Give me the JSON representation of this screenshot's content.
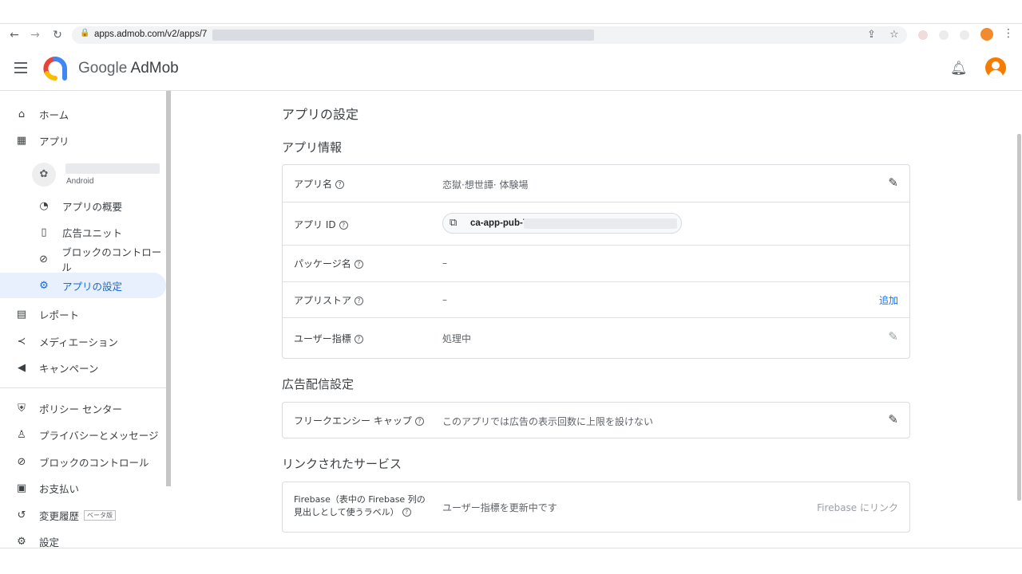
{
  "browser": {
    "url": "apps.admob.com/v2/apps/7",
    "back_icon": "arrow-left-icon",
    "forward_icon": "arrow-right-icon",
    "reload_icon": "reload-icon"
  },
  "header": {
    "brand_google": "Google",
    "brand_product": "AdMob"
  },
  "sidebar": {
    "items": [
      {
        "label": "ホーム",
        "icon": "home-icon"
      },
      {
        "label": "アプリ",
        "icon": "apps-grid-icon"
      },
      {
        "label": "アプリの概要",
        "icon": "gauge-icon"
      },
      {
        "label": "広告ユニット",
        "icon": "ad-unit-icon"
      },
      {
        "label": "ブロックのコントロール",
        "icon": "block-icon"
      },
      {
        "label": "アプリの設定",
        "icon": "settings-box-icon"
      },
      {
        "label": "レポート",
        "icon": "report-icon"
      },
      {
        "label": "メディエーション",
        "icon": "mediation-icon"
      },
      {
        "label": "キャンペーン",
        "icon": "campaign-icon"
      },
      {
        "label": "ポリシー センター",
        "icon": "shield-icon"
      },
      {
        "label": "プライバシーとメッセージ",
        "icon": "privacy-icon"
      },
      {
        "label": "ブロックのコントロール",
        "icon": "block-icon"
      },
      {
        "label": "お支払い",
        "icon": "payments-icon"
      },
      {
        "label": "変更履歴",
        "icon": "history-icon",
        "badge": "ベータ版"
      },
      {
        "label": "設定",
        "icon": "gear-icon"
      }
    ],
    "app_platform": "Android"
  },
  "main": {
    "page_title": "アプリの設定",
    "app_info": {
      "title": "アプリ情報",
      "rows": [
        {
          "label": "アプリ名",
          "value": "恋獄·想世譚· 体験場"
        },
        {
          "label": "アプリ ID",
          "value": "ca-app-pub-7"
        },
        {
          "label": "パッケージ名",
          "value": "–"
        },
        {
          "label": "アプリストア",
          "value": "–",
          "action": "追加"
        },
        {
          "label": "ユーザー指標",
          "value": "処理中"
        }
      ]
    },
    "ad_delivery": {
      "title": "広告配信設定",
      "rows": [
        {
          "label": "フリークエンシー キャップ",
          "value": "このアプリでは広告の表示回数に上限を設けない"
        }
      ]
    },
    "linked_services": {
      "title": "リンクされたサービス",
      "rows": [
        {
          "label_line1": "Firebase（表中の Firebase 列の",
          "label_line2": "見出しとして使うラベル）",
          "value": "ユーザー指標を更新中です",
          "action": "Firebase にリンク"
        }
      ]
    }
  },
  "colors": {
    "accent": "#1a73e8",
    "active_bg": "#e8f0fe",
    "active_text": "#1967d2"
  }
}
